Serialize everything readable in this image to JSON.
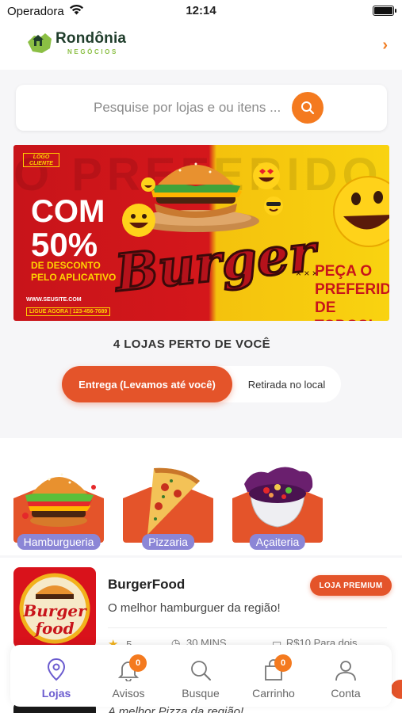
{
  "status_bar": {
    "carrier": "Operadora",
    "time": "12:14"
  },
  "header": {
    "brand_name": "Rondônia",
    "brand_sub": "NEGÓCIOS",
    "chevron_icon": "chevron-right-icon"
  },
  "search": {
    "placeholder": "Pesquise por lojas e ou itens ...",
    "button_icon": "search-icon"
  },
  "banner": {
    "logo_text": "LOGO CLIENTE",
    "ghost_text": "O PREFERIDO",
    "headline_line1": "COM",
    "headline_line2": "50%",
    "desc_line1": "DE DESCONTO",
    "desc_line2": "PELO APLICATIVO",
    "website": "WWW.SEUSITE.COM",
    "phone": "LIGUE AGORA | 123-456-7689",
    "burger_word": "Burger",
    "cta_dots": "× × ×",
    "cta": "PEÇA O PREFERIDO DE TODOS!"
  },
  "stores": {
    "title": "4 LOJAS PERTO DE VOCÊ",
    "toggle": {
      "delivery": "Entrega (Levamos até você)",
      "pickup": "Retirada no local",
      "selected": "delivery"
    }
  },
  "categories": [
    {
      "label": "Hamburgueria",
      "icon": "burger-image"
    },
    {
      "label": "Pizzaria",
      "icon": "pizza-image"
    },
    {
      "label": "Açaiteria",
      "icon": "acai-image"
    }
  ],
  "store_list": [
    {
      "name": "BurgerFood",
      "logo_text_1": "Burger",
      "logo_text_2": "food",
      "badge": "LOJA PREMIUM",
      "description": "O melhor hamburguer da região!",
      "rating": "5",
      "time": "30 MINS",
      "price": "R$10 Para dois"
    },
    {
      "description": "A melhor Pizza da região!"
    }
  ],
  "tab_bar": {
    "items": [
      {
        "label": "Lojas",
        "icon": "location-pin-icon",
        "active": true
      },
      {
        "label": "Avisos",
        "icon": "bell-icon",
        "badge": "0"
      },
      {
        "label": "Busque",
        "icon": "search-icon"
      },
      {
        "label": "Carrinho",
        "icon": "bag-icon",
        "badge": "0"
      },
      {
        "label": "Conta",
        "icon": "user-icon"
      }
    ]
  },
  "colors": {
    "accent": "#e4542a",
    "search_button": "#f47a1f",
    "active_tab": "#6b5ccf",
    "category_label": "#8b86d6"
  }
}
